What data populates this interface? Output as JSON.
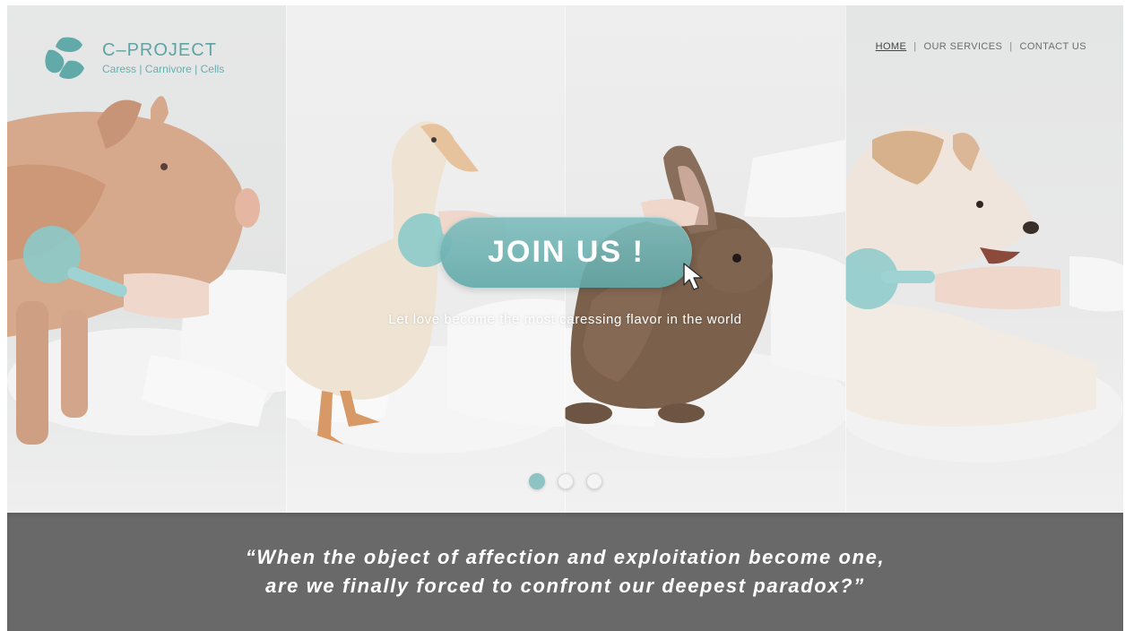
{
  "brand": {
    "title": "C–PROJECT",
    "tagline": "Caress | Carnivore | Cells",
    "logo_icon": "c-project-logo-icon",
    "accent_color": "#5fa3a3"
  },
  "nav": {
    "items": [
      {
        "label": "HOME",
        "active": true
      },
      {
        "label": "OUR SERVICES",
        "active": false
      },
      {
        "label": "CONTACT US",
        "active": false
      }
    ],
    "separator": "|"
  },
  "hero": {
    "cta_label": "JOIN US !",
    "tagline": "Let love become the most caressing flavor in the world",
    "cursor_icon": "pointer-arrow-icon",
    "slides": {
      "count": 3,
      "active_index": 0
    }
  },
  "quote": {
    "line1": "“When the object of affection and exploitation become one,",
    "line2": "are we finally forced to confront our deepest paradox?”",
    "background_color": "#696969"
  }
}
